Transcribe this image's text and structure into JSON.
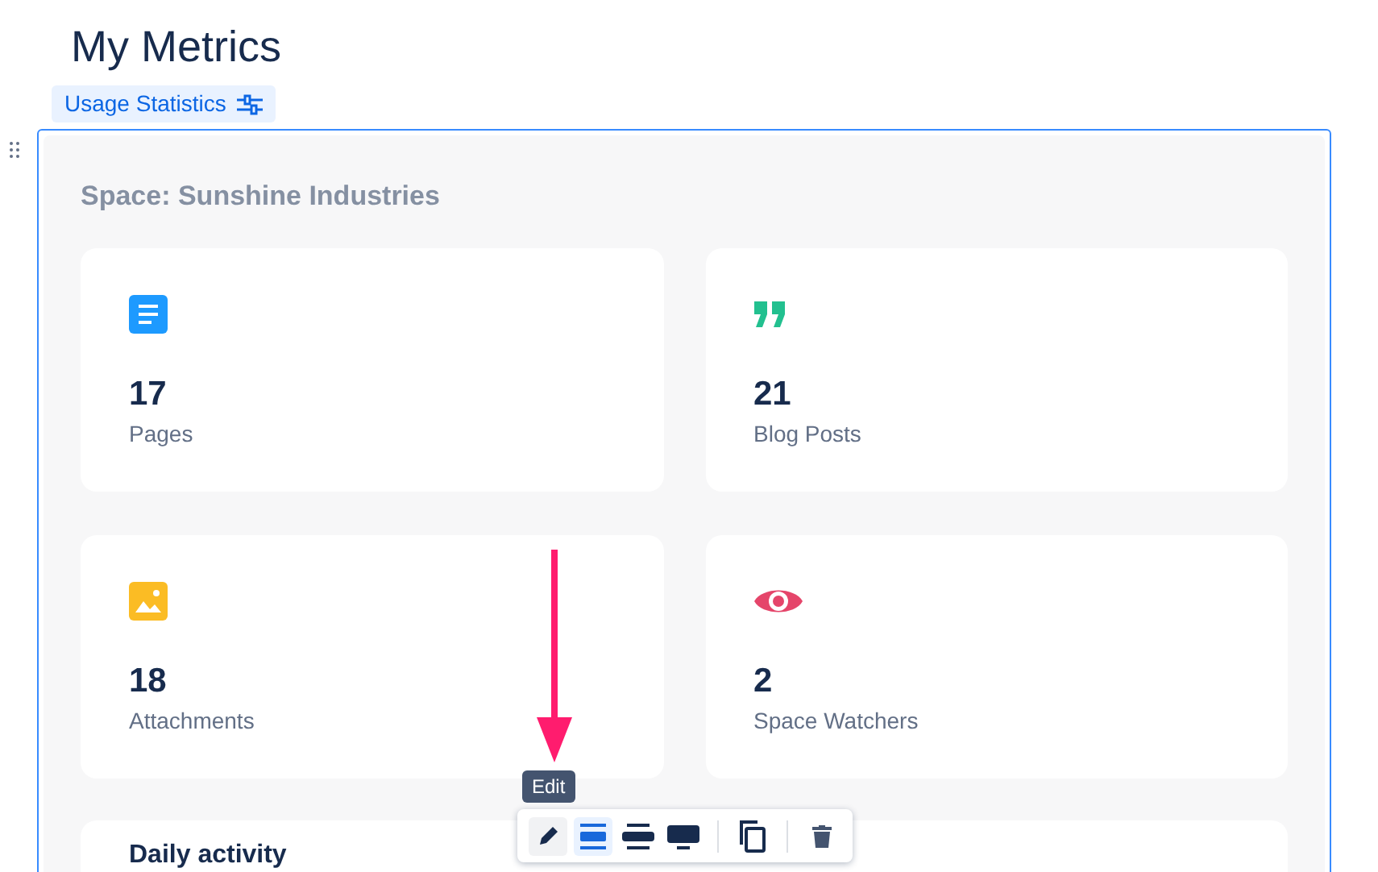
{
  "page": {
    "title": "My Metrics",
    "tag": "Usage Statistics"
  },
  "macro": {
    "heading": "Space: Sunshine Industries",
    "stats": [
      {
        "kind": "pages",
        "value": "17",
        "label": "Pages"
      },
      {
        "kind": "blogs",
        "value": "21",
        "label": "Blog Posts"
      },
      {
        "kind": "attachments",
        "value": "18",
        "label": "Attachments"
      },
      {
        "kind": "watchers",
        "value": "2",
        "label": "Space Watchers"
      }
    ],
    "activity": {
      "title": "Daily activity"
    }
  },
  "toolbar": {
    "tooltip": "Edit",
    "buttons": [
      {
        "kind": "edit",
        "selected": false,
        "hovered": true
      },
      {
        "kind": "narrow",
        "selected": true,
        "hovered": false
      },
      {
        "kind": "wide",
        "selected": false,
        "hovered": false
      },
      {
        "kind": "full",
        "selected": false,
        "hovered": false
      },
      {
        "kind": "copy",
        "selected": false,
        "hovered": false
      },
      {
        "kind": "delete",
        "selected": false,
        "hovered": false
      }
    ]
  }
}
